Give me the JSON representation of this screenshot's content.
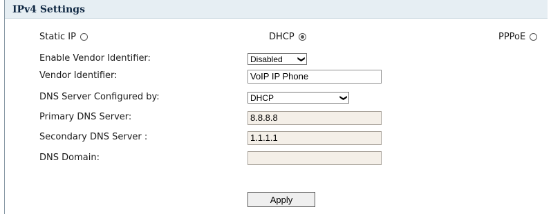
{
  "section": {
    "title": "IPv4 Settings"
  },
  "mode": {
    "options": [
      {
        "label": "Static IP",
        "selected": false
      },
      {
        "label": "DHCP",
        "selected": true
      },
      {
        "label": "PPPoE",
        "selected": false
      }
    ]
  },
  "fields": {
    "vendor_enable": {
      "label": "Enable Vendor Identifier:",
      "value": "Disabled"
    },
    "vendor_id": {
      "label": "Vendor Identifier:",
      "value": "VoIP IP Phone"
    },
    "dns_configured_by": {
      "label": "DNS Server Configured by:",
      "value": "DHCP"
    },
    "primary_dns": {
      "label": "Primary DNS Server:",
      "value": "8.8.8.8"
    },
    "secondary_dns": {
      "label": "Secondary DNS Server :",
      "value": "1.1.1.1"
    },
    "dns_domain": {
      "label": "DNS Domain:",
      "value": ""
    }
  },
  "actions": {
    "apply_label": "Apply"
  },
  "icons": {
    "select_arrow": "chevron-down-icon",
    "radio": "radio-circle-icon"
  }
}
